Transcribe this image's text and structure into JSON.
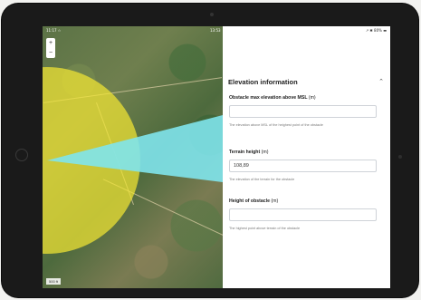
{
  "statusbar": {
    "left": "11:17 ☆",
    "time": "13:53",
    "right": "↗ ✱ 80% ▬"
  },
  "map": {
    "zoom_in": "+",
    "zoom_out": "−",
    "scale": "500 ft",
    "overlay_colors": {
      "circle": "#f2e633",
      "beam": "#7fe4ec"
    }
  },
  "panel": {
    "section_title": "Elevation information",
    "collapse_icon": "chevron-up-icon",
    "fields": [
      {
        "label": "Obstacle max elevation above MSL",
        "unit": "(m)",
        "value": "",
        "help": "The elevation above MSL of the heighest point of the obstacle"
      },
      {
        "label": "Terrain height",
        "unit": "(m)",
        "value": "108,89",
        "help": "The elevation of the terrain for the obstacle"
      },
      {
        "label": "Height of obstacle",
        "unit": "(m)",
        "value": "",
        "help": "The highest point above terrain of the obstacle"
      }
    ]
  }
}
